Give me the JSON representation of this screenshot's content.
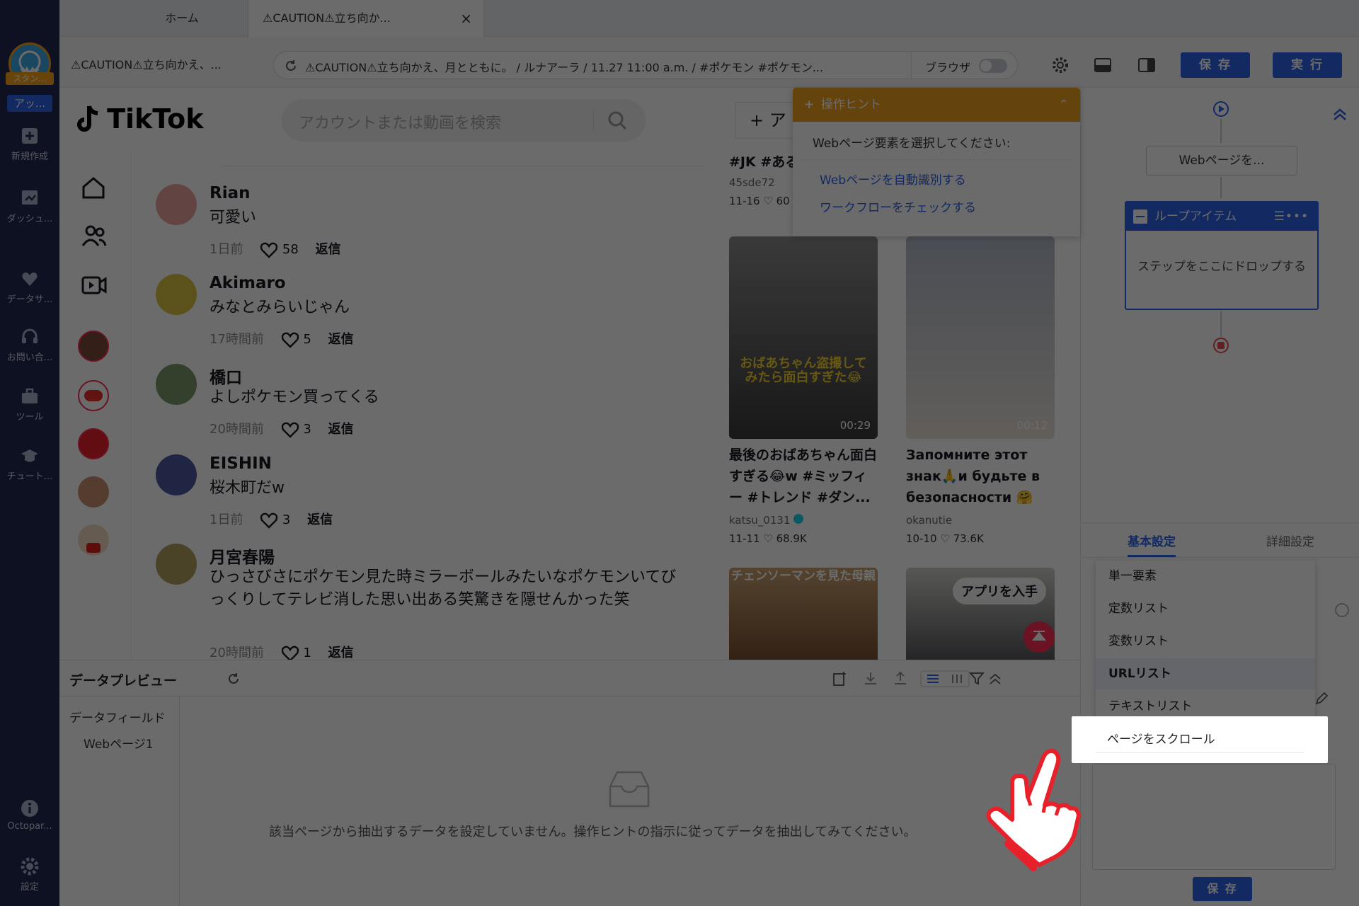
{
  "sidebar": {
    "user_badge": "スタン...",
    "app_badge": "アッ...",
    "items": [
      {
        "label": "新規作成",
        "icon": "plus-square-icon"
      },
      {
        "label": "ダッシュ...",
        "icon": "dashboard-icon"
      },
      {
        "label": "データサ...",
        "icon": "heart-data-icon"
      },
      {
        "label": "お問い合...",
        "icon": "headset-icon"
      },
      {
        "label": "ツール",
        "icon": "toolbox-icon"
      },
      {
        "label": "チュート...",
        "icon": "graduation-cap-icon"
      }
    ],
    "bottom_items": [
      {
        "label": "Octopar...",
        "icon": "info-icon"
      },
      {
        "label": "設定",
        "icon": "gear-icon"
      }
    ]
  },
  "tabs": [
    {
      "label": "ホーム"
    },
    {
      "label": "⚠CAUTION⚠立ち向か...",
      "close": "×"
    }
  ],
  "toolbar": {
    "task_name": "⚠CAUTION⚠立ち向かえ、...",
    "url": "⚠CAUTION⚠立ち向かえ、月とともに。 / ルナアーラ / 11.27 11:00 a.m. / #ポケモン #ポケモン...",
    "browser_label": "ブラウザ",
    "save_label": "保 存",
    "run_label": "実 行"
  },
  "tiktok": {
    "logo": "TikTok",
    "search_placeholder": "アカウントまたは動画を検索",
    "upload_label": "+ ア",
    "comments": [
      {
        "name": "Rian",
        "text": "可愛い",
        "time": "1日前",
        "likes": "58",
        "reply": "返信"
      },
      {
        "name": "Akimaro",
        "text": "みなとみらいじゃん",
        "time": "17時間前",
        "likes": "5",
        "reply": "返信"
      },
      {
        "name": "橋口",
        "text": "よしポケモン買ってくる",
        "time": "20時間前",
        "likes": "3",
        "reply": "返信"
      },
      {
        "name": "EISHIN",
        "text": "桜木町だw",
        "time": "1日前",
        "likes": "3",
        "reply": "返信"
      },
      {
        "name": "月宮春陽",
        "text": "ひっさびさにポケモン見た時ミラーボールみたいなポケモンいてびっくりしてテレビ消した思い出ある笑驚きを隠せんかった笑",
        "time": "20時間前",
        "likes": "1",
        "reply": "返信"
      }
    ],
    "top_video": {
      "title": "#JK #ある",
      "user": "45sde72",
      "date": "11-16",
      "likes": "60"
    },
    "videos": [
      {
        "title": "最後のおばあちゃん面白すぎる😂w #ミッフィー #トレンド #ダン...",
        "user": "katsu_0131",
        "date": "11-11",
        "likes": "68.9K",
        "duration": "00:29",
        "overlay": "おばあちゃん盗撮してみたら面白すぎた😂"
      },
      {
        "title": "Запомните этот знак🙏и будьте в безопасности 🤗",
        "user": "okanutie",
        "date": "10-10",
        "likes": "73.6K",
        "duration": "00:12",
        "overlay": ""
      },
      {
        "overlay": "チェンソーマンを見た母親"
      },
      {
        "overlay": "アプリを入手"
      }
    ]
  },
  "hint": {
    "title": "操作ヒント",
    "prompt": "Webページ要素を選択してください:",
    "link1": "Webページを自動識別する",
    "link2": "ワークフローをチェックする"
  },
  "flow": {
    "node_webpage": "Webページを...",
    "loop_title": "ループアイテム",
    "drop_text": "ステップをここにドロップする"
  },
  "settings": {
    "tab_basic": "基本設定",
    "tab_advanced": "詳細設定",
    "options": [
      "単一要素",
      "定数リスト",
      "変数リスト",
      "URLリスト",
      "テキストリスト",
      "ページをスクロール"
    ],
    "save_label": "保 存"
  },
  "preview": {
    "title": "データプレビュー",
    "field_label": "データフィールド",
    "page_label": "Webページ1",
    "empty_text": "該当ページから抽出するデータを設定していません。操作ヒントの指示に従ってデータを抽出してみてください。"
  },
  "colors": {
    "sidebar": "#1f2a52",
    "accent": "#2b63e6",
    "hint_header": "#f0a020",
    "tiktok_red": "#fe2c55"
  }
}
